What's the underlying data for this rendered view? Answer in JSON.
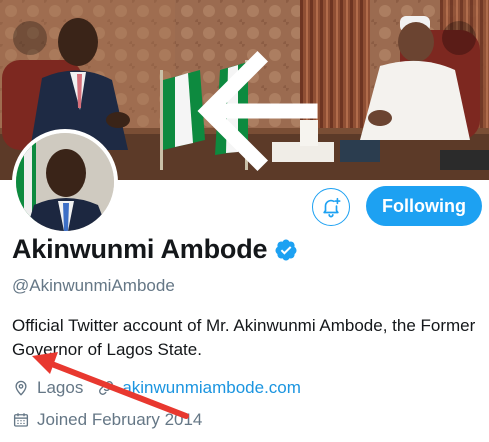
{
  "profile": {
    "name": "Akinwunmi Ambode",
    "handle": "@AkinwunmiAmbode",
    "bio": "Official Twitter account of Mr. Akinwunmi Ambode, the Former Governor of Lagos State.",
    "location": "Lagos",
    "website": "akinwunmiambode.com",
    "joined": "Joined February 2014",
    "verified": true
  },
  "actions": {
    "following_label": "Following"
  },
  "icons": {
    "back": "back-arrow-icon",
    "more": "more-vertical-icon",
    "notify": "bell-plus-icon",
    "verified": "verified-badge-icon",
    "location": "location-pin-icon",
    "link": "link-icon",
    "calendar": "calendar-icon"
  },
  "colors": {
    "accent": "#1da1f2",
    "link": "#1b95e0",
    "secondary_text": "#657786",
    "primary_text": "#14171a",
    "annotation": "#e8382f"
  }
}
